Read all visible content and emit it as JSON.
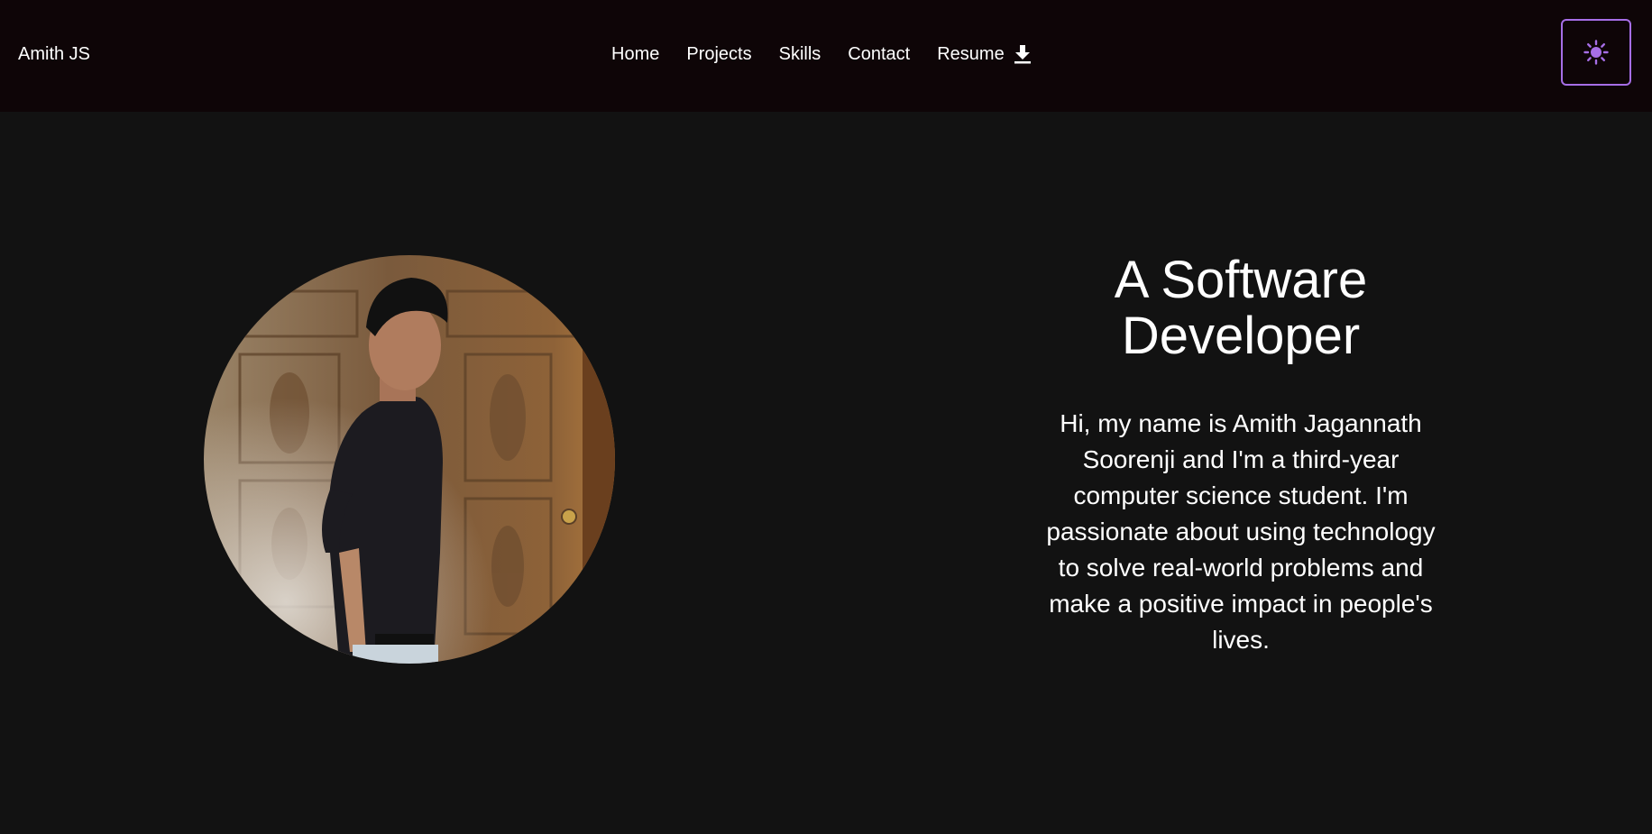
{
  "navbar": {
    "brand": "Amith JS",
    "links": [
      {
        "label": "Home"
      },
      {
        "label": "Projects"
      },
      {
        "label": "Skills"
      },
      {
        "label": "Contact"
      },
      {
        "label": "Resume",
        "icon": "download-icon"
      }
    ],
    "theme_toggle": {
      "icon": "sun-icon",
      "accent_color": "#a66ee6"
    }
  },
  "hero": {
    "photo": {
      "shape": "circle",
      "subject": "portrait-photo"
    },
    "title": "A Software Developer",
    "bio": "Hi, my name is Amith Jagannath Soorenji and I'm a third-year computer science student. I'm passionate about using technology to solve real-world problems and make a positive impact in people's lives."
  },
  "colors": {
    "page_background": "#121212",
    "navbar_background": "#0e0507",
    "text": "#ffffff",
    "accent": "#a66ee6"
  }
}
